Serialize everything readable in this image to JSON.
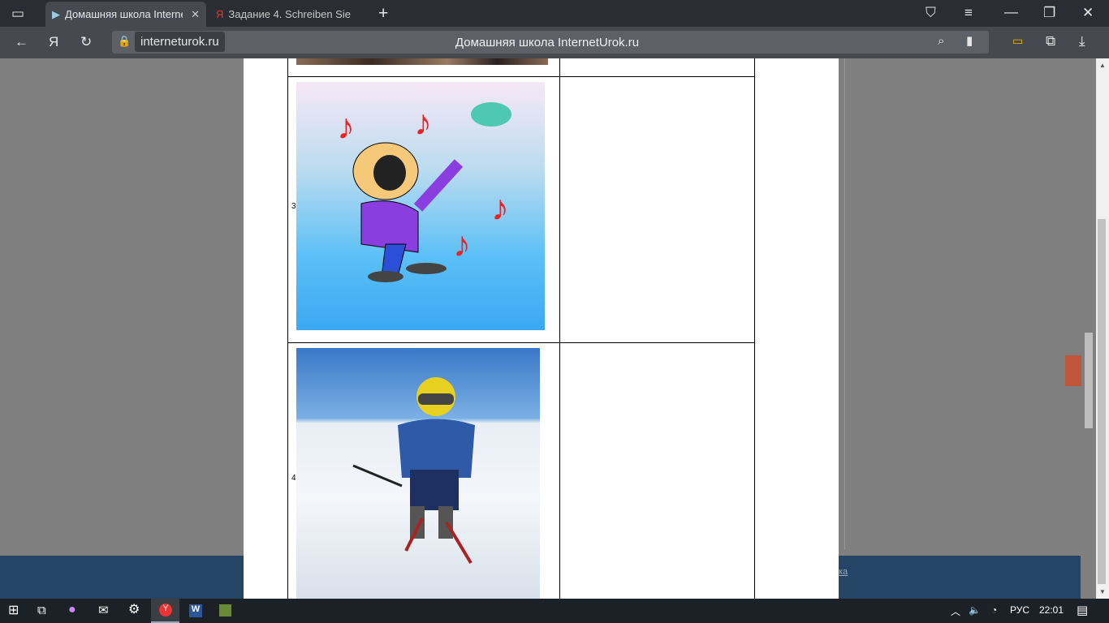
{
  "browser": {
    "tabs": [
      {
        "label": "Домашняя школа InternetUrok.ru",
        "active": true
      },
      {
        "label": "Задание 4. Schreiben Sie d",
        "active": false
      }
    ],
    "url": "interneturok.ru",
    "page_title": "Домашняя школа InternetUrok.ru"
  },
  "document": {
    "rows": [
      {
        "number": "3",
        "image": "singing-boy-cartoon"
      },
      {
        "number": "4",
        "image": "boy-skiing"
      }
    ]
  },
  "footer": {
    "link_fragment": "ка"
  },
  "taskbar": {
    "language": "РУС",
    "time": "22:01"
  }
}
